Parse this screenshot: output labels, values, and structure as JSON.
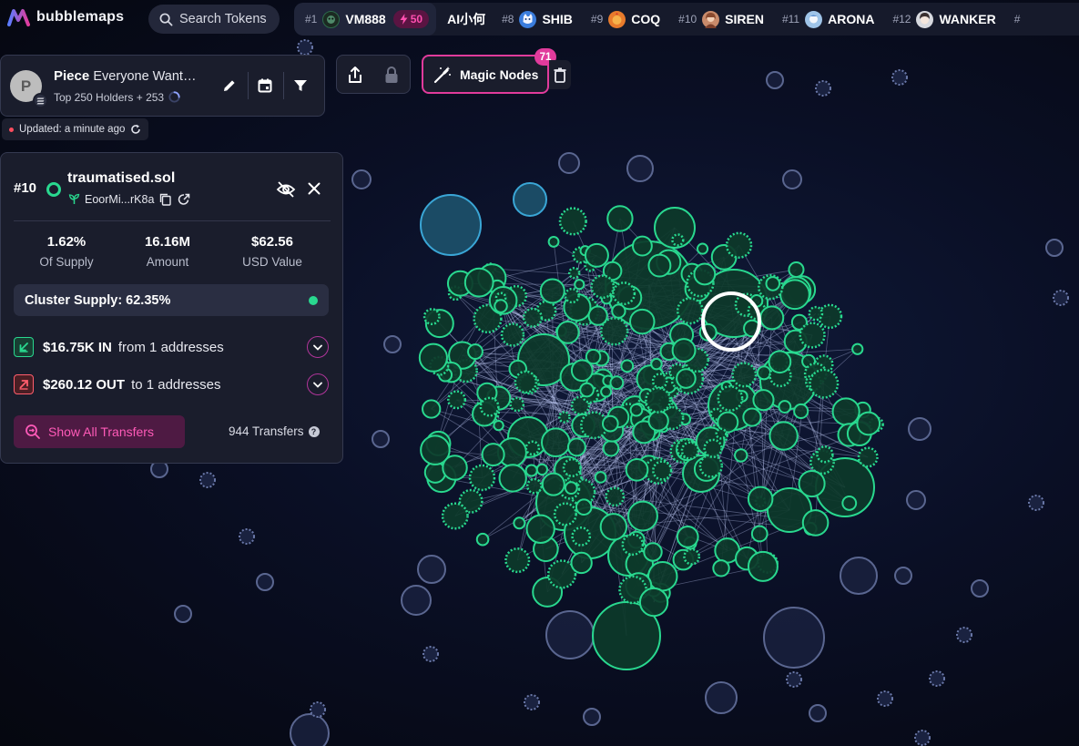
{
  "app": {
    "name": "bubblemaps",
    "search_placeholder": "Search Tokens"
  },
  "trending": [
    {
      "rank": "#1",
      "symbol": "VM888",
      "logo": "vm888-logo",
      "boost": "50",
      "color": "#2c6b4a"
    },
    {
      "rank": "",
      "symbol": "AI小何",
      "logo": "",
      "color": ""
    },
    {
      "rank": "#8",
      "symbol": "SHIB",
      "logo": "shib-logo",
      "color": "#3b7ddd"
    },
    {
      "rank": "#9",
      "symbol": "COQ",
      "logo": "coq-logo",
      "color": "#e87b2c"
    },
    {
      "rank": "#10",
      "symbol": "SIREN",
      "logo": "siren-logo",
      "color": "#c98b6b"
    },
    {
      "rank": "#11",
      "symbol": "ARONA",
      "logo": "arona-logo",
      "color": "#9fc4e8"
    },
    {
      "rank": "#12",
      "symbol": "WANKER",
      "logo": "wanker-logo",
      "color": "#8a8f9f"
    },
    {
      "rank": "#",
      "symbol": "",
      "logo": "",
      "color": ""
    }
  ],
  "token": {
    "avatar_letter": "P",
    "symbol": "Piece",
    "name": "Everyone Want…",
    "subtitle": "Top 250 Holders + 253",
    "updated": "Updated: a minute ago"
  },
  "toolbar": {
    "magic_nodes_label": "Magic Nodes",
    "magic_nodes_count": "71"
  },
  "wallet": {
    "rank": "#10",
    "name": "traumatised.sol",
    "address": "EoorMi...rK8a",
    "stats": [
      {
        "value": "1.62%",
        "label": "Of Supply"
      },
      {
        "value": "16.16M",
        "label": "Amount"
      },
      {
        "value": "$62.56",
        "label": "USD Value"
      }
    ],
    "cluster_supply": "Cluster Supply: 62.35%",
    "inflow": {
      "amount": "$16.75K IN",
      "text": "from 1 addresses"
    },
    "outflow": {
      "amount": "$260.12 OUT",
      "text": "to 1 addresses"
    },
    "show_transfers_label": "Show All Transfers",
    "transfers_count": "944 Transfers"
  },
  "colors": {
    "accent_pink": "#e13b9c",
    "bubble_green": "#29d88f",
    "bubble_blue_outline": "#3aa6d6",
    "bubble_gray_outline": "#3a4266"
  }
}
